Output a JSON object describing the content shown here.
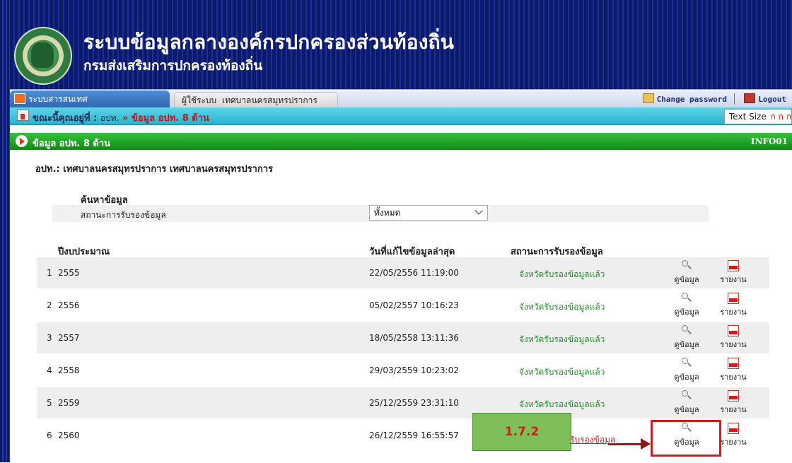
{
  "header": {
    "title": "ระบบข้อมูลกลางองค์กรปกครองส่วนท้องถิ่น",
    "subtitle": "กรมส่งเสริมการปกครองท้องถิ่น"
  },
  "tabbar": {
    "main_tab": "ระบบสารสนเทศ",
    "user_label": "ผู้ใช้ระบบ",
    "user_name": "เทศบาลนครสมุทรปราการ",
    "change_password": "Change password",
    "logout": "Logout"
  },
  "breadcrumb": {
    "prefix": "ขณะนี้คุณอยู่ที่ :",
    "loc": "อปท.",
    "sep": "»",
    "current": "ข้อมูล อปท. 8 ด้าน",
    "text_size_label": "Text Size",
    "text_size_glyphs": "ก ก ก"
  },
  "section": {
    "title": "ข้อมูล อปท. 8 ด้าน",
    "code": "INFO01"
  },
  "org_line": "อปท.: เทศบาลนครสมุทรปราการ เทศบาลนครสมุทรปราการ",
  "search": {
    "title": "ค้นหาข้อมูล",
    "status_label": "สถานะการรับรองข้อมูล",
    "status_value": "ทั้งหมด"
  },
  "table": {
    "headers": {
      "year": "ปีงบประมาณ",
      "date": "วันที่แก้ไขข้อมูลล่าสุด",
      "status": "สถานะการรับรองข้อมูล"
    },
    "view_label": "ดูข้อมูล",
    "report_label": "รายงาน",
    "rows": [
      {
        "no": "1",
        "year": "2555",
        "date": "22/05/2556 11:19:00",
        "status": "จังหวัดรับรองข้อมูลแล้ว"
      },
      {
        "no": "2",
        "year": "2556",
        "date": "05/02/2557 10:16:23",
        "status": "จังหวัดรับรองข้อมูลแล้ว"
      },
      {
        "no": "3",
        "year": "2557",
        "date": "18/05/2558 13:11:36",
        "status": "จังหวัดรับรองข้อมูลแล้ว"
      },
      {
        "no": "4",
        "year": "2558",
        "date": "29/03/2559 10:23:02",
        "status": "จังหวัดรับรองข้อมูลแล้ว"
      },
      {
        "no": "5",
        "year": "2559",
        "date": "25/12/2559 23:31:10",
        "status": "จังหวัดรับรองข้อมูลแล้ว"
      },
      {
        "no": "6",
        "year": "2560",
        "date": "26/12/2559 16:55:57",
        "status": "รับรองข้อมูล"
      }
    ]
  },
  "annotation": {
    "label": "1.7.2",
    "color": "#d61a1a"
  }
}
